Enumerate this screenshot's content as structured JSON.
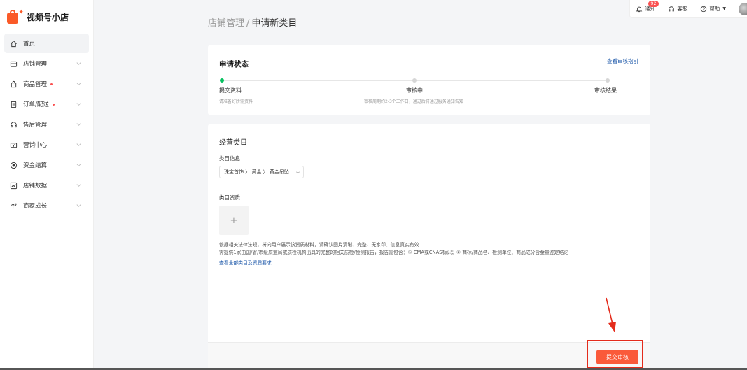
{
  "brand": {
    "name": "视频号小店"
  },
  "nav": {
    "items": [
      {
        "label": "首页",
        "icon": "home-icon",
        "active": true,
        "dot": false,
        "chevron": false
      },
      {
        "label": "店铺管理",
        "icon": "store-icon",
        "dot": false,
        "chevron": true
      },
      {
        "label": "商品管理",
        "icon": "bag-icon",
        "dot": true,
        "chevron": true
      },
      {
        "label": "订单/配送",
        "icon": "order-icon",
        "dot": true,
        "chevron": true
      },
      {
        "label": "售后管理",
        "icon": "headset-icon",
        "dot": false,
        "chevron": true
      },
      {
        "label": "营销中心",
        "icon": "ticket-icon",
        "dot": false,
        "chevron": true
      },
      {
        "label": "资金结算",
        "icon": "coin-icon",
        "dot": false,
        "chevron": true
      },
      {
        "label": "店铺数据",
        "icon": "chart-icon",
        "dot": false,
        "chevron": true
      },
      {
        "label": "商家成长",
        "icon": "sprout-icon",
        "dot": false,
        "chevron": true
      }
    ]
  },
  "topbar": {
    "notice_label": "通知",
    "notice_count": "92",
    "service_label": "客服",
    "help_label": "帮助"
  },
  "breadcrumb": {
    "parent": "店铺管理",
    "separator": "/",
    "current": "申请新类目"
  },
  "status": {
    "title": "申请状态",
    "guide_link": "查看审核指引",
    "steps": [
      {
        "name": "提交资料",
        "desc": "请准备好所需资料",
        "done": true
      },
      {
        "name": "审核中",
        "desc": "审核周期约2-3个工作日，通过后将通过服务通知告知",
        "done": false
      },
      {
        "name": "审核结果",
        "desc": "",
        "done": false
      }
    ]
  },
  "category": {
    "title": "经营类目",
    "info_label": "类目信息",
    "selected_path": "珠宝首饰 〉 黄金 〉 黄金吊坠",
    "qualification_label": "类目资质",
    "upload_plus": "+",
    "req_line1": "依据相关法律法规，将向用户展示该资质材料，请确认图片清晰、完整、无水印、信息真实有效",
    "req_line2": "需提供1家由国/省/市级质监局或质检机构出具的完整的相关质检/检测报告，报告需包含：① CMA或CNAS标识；② 商标/商品名、检测单位、商品成分含金量鉴定结论",
    "req_link": "查看全部类目及资质要求",
    "submit_label": "提交审核"
  },
  "colors": {
    "accent": "#fa5a3a",
    "link": "#1a56a8",
    "success": "#07c160",
    "annotation": "#e42c1c"
  }
}
